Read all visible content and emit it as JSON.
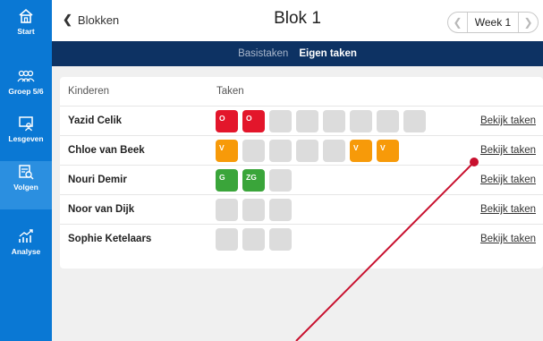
{
  "sidebar": {
    "items": [
      {
        "label": "Start",
        "icon": "home-icon",
        "active": false
      },
      {
        "label": "Groep 5/6",
        "icon": "group-icon",
        "active": false
      },
      {
        "label": "Lesgeven",
        "icon": "teach-icon",
        "active": false
      },
      {
        "label": "Volgen",
        "icon": "track-icon",
        "active": true
      },
      {
        "label": "Analyse",
        "icon": "chart-icon",
        "active": false
      }
    ]
  },
  "header": {
    "back_label": "Blokken",
    "title": "Blok 1",
    "week_label": "Week 1"
  },
  "tabs": [
    {
      "label": "Basistaken",
      "active": false
    },
    {
      "label": "Eigen taken",
      "active": true
    }
  ],
  "table": {
    "headers": {
      "name": "Kinderen",
      "tasks": "Taken"
    },
    "view_label": "Bekijk taken",
    "rows": [
      {
        "name": "Yazid Celik",
        "tasks": [
          {
            "label": "O",
            "status": "red"
          },
          {
            "label": "O",
            "status": "red"
          },
          {
            "label": "",
            "status": "empty"
          },
          {
            "label": "",
            "status": "empty"
          },
          {
            "label": "",
            "status": "empty"
          },
          {
            "label": "",
            "status": "empty"
          },
          {
            "label": "",
            "status": "empty"
          },
          {
            "label": "",
            "status": "empty"
          }
        ]
      },
      {
        "name": "Chloe van Beek",
        "tasks": [
          {
            "label": "V",
            "status": "orange"
          },
          {
            "label": "",
            "status": "empty"
          },
          {
            "label": "",
            "status": "empty"
          },
          {
            "label": "",
            "status": "empty"
          },
          {
            "label": "",
            "status": "empty"
          },
          {
            "label": "V",
            "status": "orange"
          },
          {
            "label": "V",
            "status": "orange"
          }
        ]
      },
      {
        "name": "Nouri Demir",
        "tasks": [
          {
            "label": "G",
            "status": "green"
          },
          {
            "label": "ZG",
            "status": "green"
          },
          {
            "label": "",
            "status": "empty"
          }
        ]
      },
      {
        "name": "Noor van Dijk",
        "tasks": [
          {
            "label": "",
            "status": "empty"
          },
          {
            "label": "",
            "status": "empty"
          },
          {
            "label": "",
            "status": "empty"
          }
        ]
      },
      {
        "name": "Sophie Ketelaars",
        "tasks": [
          {
            "label": "",
            "status": "empty"
          },
          {
            "label": "",
            "status": "empty"
          },
          {
            "label": "",
            "status": "empty"
          }
        ]
      }
    ]
  },
  "colors": {
    "sidebar": "#0a78d4",
    "tabbar": "#0d3263",
    "red": "#e3162b",
    "orange": "#f79a09",
    "green": "#3aa53a",
    "empty": "#dcdcdc",
    "pointer": "#c8102e"
  }
}
